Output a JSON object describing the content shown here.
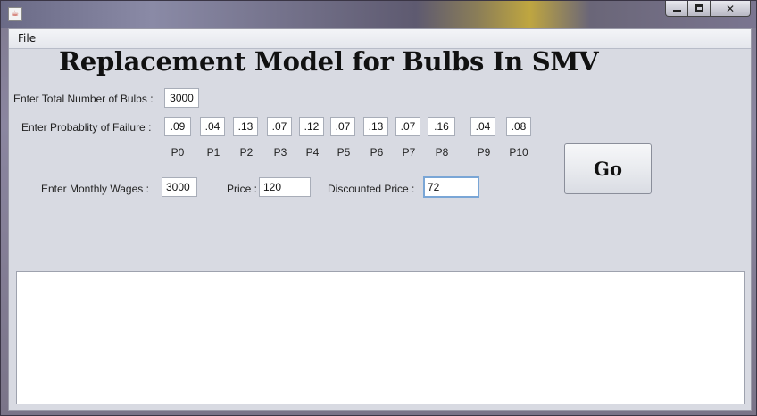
{
  "window": {
    "app_icon": "java-cup-icon",
    "controls": [
      "minimize",
      "maximize",
      "close"
    ]
  },
  "menu": {
    "file": "File"
  },
  "heading": "Replacement Model for Bulbs In SMV",
  "bulbs": {
    "label": "Enter Total Number of Bulbs :",
    "value": "3000"
  },
  "failure": {
    "label": "Enter Probablity of Failure :",
    "probabilities": [
      {
        "name": "P0",
        "value": ".09"
      },
      {
        "name": "P1",
        "value": ".04"
      },
      {
        "name": "P2",
        "value": ".13"
      },
      {
        "name": "P3",
        "value": ".07"
      },
      {
        "name": "P4",
        "value": ".12"
      },
      {
        "name": "P5",
        "value": ".07"
      },
      {
        "name": "P6",
        "value": ".13"
      },
      {
        "name": "P7",
        "value": ".07"
      },
      {
        "name": "P8",
        "value": ".16"
      },
      {
        "name": "P9",
        "value": ".04"
      },
      {
        "name": "P10",
        "value": ".08"
      }
    ]
  },
  "wages": {
    "label": "Enter Monthly Wages :",
    "value": "3000"
  },
  "price": {
    "label": "Price :",
    "value": "120"
  },
  "discounted": {
    "label": "Discounted Price :",
    "value": "72"
  },
  "go_button": "Go",
  "output": ""
}
